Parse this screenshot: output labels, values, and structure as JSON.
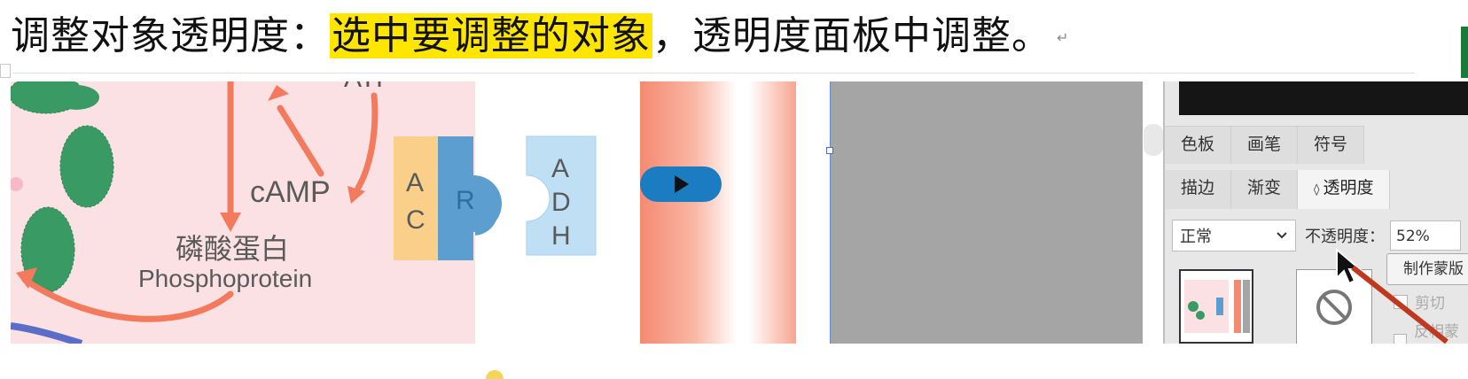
{
  "heading": {
    "prefix": "调整对象透明度：",
    "highlight": "选中要调整的对象",
    "suffix": "，透明度面板中调整。",
    "return_mark": "↵"
  },
  "figure": {
    "camp": "cAMP",
    "atp_partial": "ATP",
    "protein_cn": "磷酸蛋白",
    "protein_en": "Phosphoprotein",
    "ac_letters": [
      "A",
      "C"
    ],
    "r_letter": "R",
    "adh_letters": [
      "A",
      "D",
      "H"
    ]
  },
  "colors": {
    "highlight": "#ffe600",
    "bio_bg": "#fbe1e3",
    "arrow": "#f47a5e",
    "play": "#1c7cc2"
  },
  "panel": {
    "tabs_row1": [
      "色板",
      "画笔",
      "符号"
    ],
    "tabs_row2": [
      "描边",
      "渐变",
      "透明度"
    ],
    "active_tab": "透明度",
    "active_tab_prefix": "◊",
    "blend_mode": "正常",
    "opacity_label": "不透明度：",
    "opacity_value": "52%",
    "make_mask_label": "制作蒙版",
    "clip_label": "剪切",
    "invert_label": "反相蒙版"
  },
  "icons": {
    "play": "play-icon",
    "chevron": "chevron-down-icon",
    "no": "no-entry-icon",
    "cursor": "cursor-arrow-icon"
  }
}
